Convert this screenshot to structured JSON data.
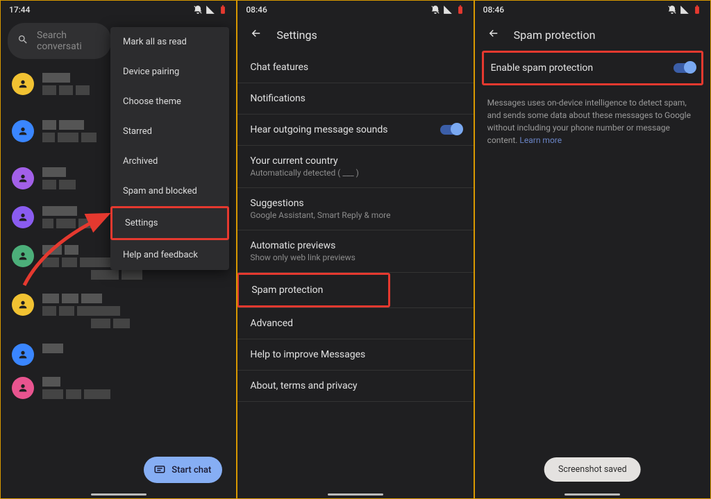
{
  "panel1": {
    "time": "17:44",
    "search_placeholder": "Search conversati",
    "menu": [
      "Mark all as read",
      "Device pairing",
      "Choose theme",
      "Starred",
      "Archived",
      "Spam and blocked",
      "Settings",
      "Help and feedback"
    ],
    "fab_label": "Start chat"
  },
  "panel2": {
    "time": "08:46",
    "title": "Settings",
    "items": [
      {
        "label": "Chat features"
      },
      {
        "label": "Notifications"
      },
      {
        "label": "Hear outgoing message sounds",
        "toggle": true
      },
      {
        "label": "Your current country",
        "sub": "Automatically detected ( ___ )"
      },
      {
        "label": "Suggestions",
        "sub": "Google Assistant, Smart Reply & more"
      },
      {
        "label": "Automatic previews",
        "sub": "Show only web link previews"
      },
      {
        "label": "Spam protection",
        "highlight": true
      },
      {
        "label": "Advanced"
      },
      {
        "label": "Help to improve Messages"
      },
      {
        "label": "About, terms and privacy"
      }
    ]
  },
  "panel3": {
    "time": "08:46",
    "title": "Spam protection",
    "enable_label": "Enable spam protection",
    "desc": "Messages uses on-device intelligence to detect spam, and sends some data about these messages to Google without including your phone number or message content.",
    "learn_more": "Learn more",
    "snackbar": "Screenshot saved"
  }
}
